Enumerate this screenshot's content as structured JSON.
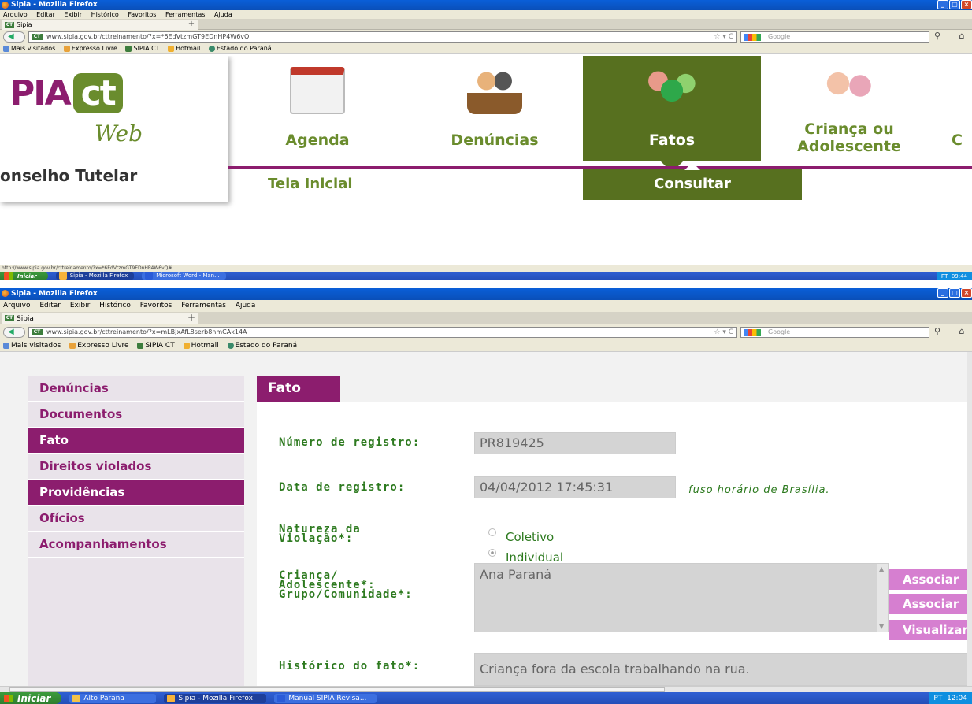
{
  "window": {
    "title": "Sipia - Mozilla Firefox",
    "menu": [
      "Arquivo",
      "Editar",
      "Exibir",
      "Histórico",
      "Favoritos",
      "Ferramentas",
      "Ajuda"
    ],
    "tab_title": "Sipia",
    "new_tab": "+",
    "url_top": "www.sipia.gov.br/cttreinamento/?x=*6EdVtzmGT9EDnHP4W6vQ",
    "url_bottom": "www.sipia.gov.br/cttreinamento/?x=mLBJxAfL8serb8nmCAk14A",
    "search_placeholder": "Google",
    "bookmarks": [
      "Mais visitados",
      "Expresso Livre",
      "SIPIA CT",
      "Hotmail",
      "Estado do Paraná"
    ],
    "status_url": "http://www.sipia.gov.br/cttreinamento/?x=*6EdVtzmGT9EDnHP4W6vQ#"
  },
  "top_page": {
    "logo_main": "PIA",
    "logo_ct": "ct",
    "logo_web": "Web",
    "logo_sub": "onselho Tutelar",
    "nav": [
      "Agenda",
      "Denúncias",
      "Fatos",
      "Criança ou Adolescente",
      "C"
    ],
    "subnav_left": "Tela Inicial",
    "subnav_active": "Consultar"
  },
  "taskbar_top": {
    "start": "Iniciar",
    "items": [
      "Sipia - Mozilla Firefox",
      "Microsoft Word - Man..."
    ],
    "tray": "PT",
    "clock": "09:44"
  },
  "sidebar": {
    "items": [
      {
        "label": "Denúncias",
        "active": false
      },
      {
        "label": "Documentos",
        "active": false
      },
      {
        "label": "Fato",
        "active": true
      },
      {
        "label": "Direitos violados",
        "active": false
      },
      {
        "label": "Providências",
        "active": true
      },
      {
        "label": "Ofícios",
        "active": false
      },
      {
        "label": "Acompanhamentos",
        "active": false
      }
    ]
  },
  "form": {
    "header": "Fato",
    "registro_label": "Número de registro:",
    "registro_value": "PR819425",
    "data_label": "Data de registro:",
    "data_value": "04/04/2012 17:45:31",
    "data_note": "fuso horário de Brasília.",
    "natureza_label_1": "Natureza da",
    "natureza_label_2": "Violação*:",
    "natureza_options": [
      {
        "label": "Coletivo",
        "checked": false
      },
      {
        "label": "Individual",
        "checked": true
      }
    ],
    "crianca_label_1": "Criança/",
    "crianca_label_2": "Adolescente*:",
    "crianca_label_3": "Grupo/Comunidade*:",
    "crianca_value": "Ana Paraná",
    "buttons": [
      "Associar",
      "Associar",
      "Visualizar"
    ],
    "historico_label": "Histórico do fato*:",
    "historico_value": "Criança fora da escola trabalhando na rua."
  },
  "taskbar_bottom": {
    "start": "Iniciar",
    "items": [
      "Alto Parana",
      "Sipia - Mozilla Firefox",
      "Manual SIPIA Revisa..."
    ],
    "tray": "PT",
    "clock": "12:04"
  },
  "colors": {
    "purple": "#8c1d6e",
    "green": "#57701f",
    "label_green": "#2d7a1f"
  }
}
